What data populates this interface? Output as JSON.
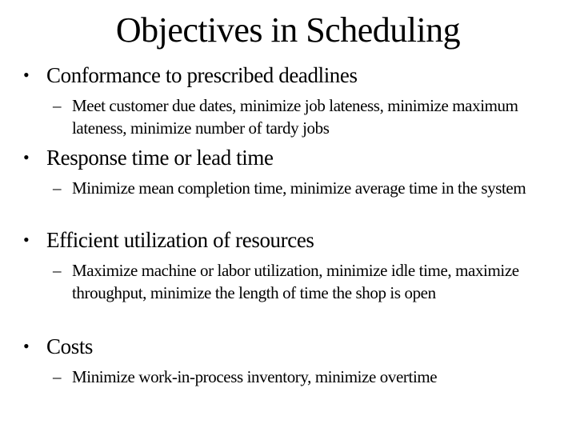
{
  "slide": {
    "title": "Objectives in Scheduling",
    "bullet_glyph": "•",
    "dash_glyph": "–",
    "items": [
      {
        "label": "Conformance to prescribed deadlines",
        "sub": "Meet customer due dates, minimize job lateness, minimize maximum lateness, minimize number of tardy jobs"
      },
      {
        "label": "Response time or lead time",
        "sub": "Minimize mean completion time, minimize average time in the system"
      },
      {
        "label": "Efficient utilization of resources",
        "sub": "Maximize machine or labor utilization, minimize idle time, maximize throughput, minimize the length of time the shop is open"
      },
      {
        "label": "Costs",
        "sub": "Minimize work-in-process inventory, minimize overtime"
      }
    ]
  }
}
